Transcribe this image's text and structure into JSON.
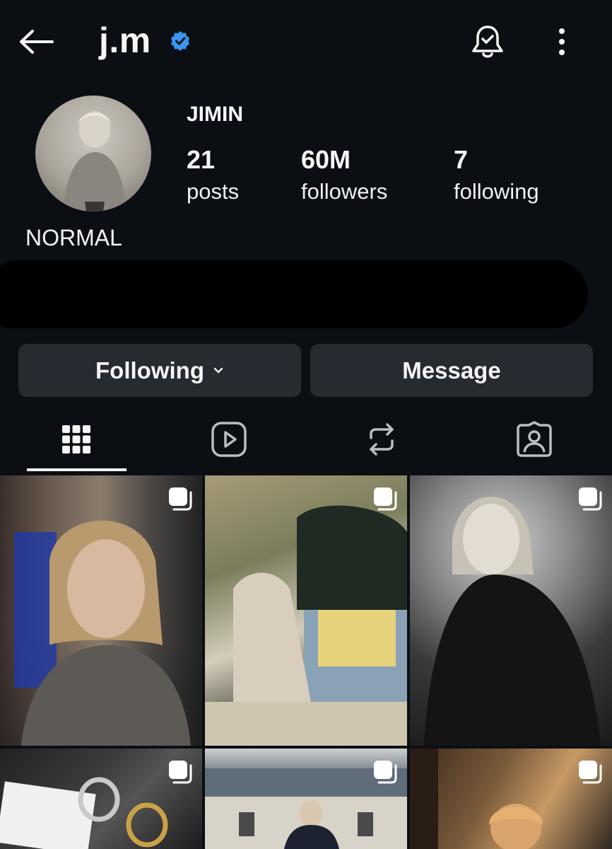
{
  "header": {
    "username": "j.m",
    "back_icon": "arrow-left-icon",
    "verified_icon": "verified-badge-icon",
    "notifications_icon": "bell-check-icon",
    "more_icon": "more-vertical-icon"
  },
  "profile": {
    "display_name": "JIMIN",
    "posts_count": "21",
    "posts_label": "posts",
    "followers_count": "60M",
    "followers_label": "followers",
    "following_count": "7",
    "following_label": "following",
    "bio_name": "NORMAL"
  },
  "actions": {
    "following_label": "Following",
    "message_label": "Message"
  },
  "tabs": [
    {
      "name": "posts-grid",
      "icon": "grid-icon",
      "active": true
    },
    {
      "name": "reels",
      "icon": "reels-play-icon",
      "active": false
    },
    {
      "name": "reposts",
      "icon": "repost-icon",
      "active": false
    },
    {
      "name": "tagged",
      "icon": "tagged-person-icon",
      "active": false
    }
  ],
  "colors": {
    "background": "#0b0f14",
    "button_bg": "#262a31",
    "verified": "#3797f0",
    "text": "#f5f5f5"
  }
}
